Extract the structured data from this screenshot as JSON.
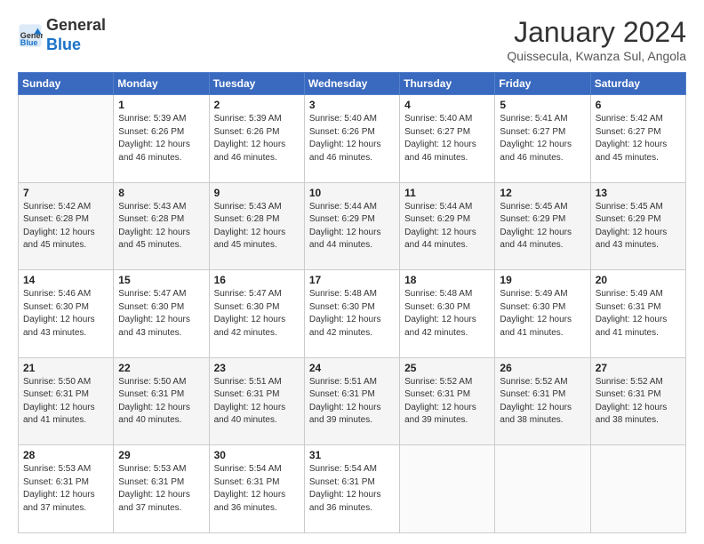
{
  "logo": {
    "line1": "General",
    "line2": "Blue"
  },
  "header": {
    "title": "January 2024",
    "location": "Quissecula, Kwanza Sul, Angola"
  },
  "weekdays": [
    "Sunday",
    "Monday",
    "Tuesday",
    "Wednesday",
    "Thursday",
    "Friday",
    "Saturday"
  ],
  "weeks": [
    [
      {
        "day": "",
        "sunrise": "",
        "sunset": "",
        "daylight": ""
      },
      {
        "day": "1",
        "sunrise": "5:39 AM",
        "sunset": "6:26 PM",
        "daylight": "12 hours and 46 minutes."
      },
      {
        "day": "2",
        "sunrise": "5:39 AM",
        "sunset": "6:26 PM",
        "daylight": "12 hours and 46 minutes."
      },
      {
        "day": "3",
        "sunrise": "5:40 AM",
        "sunset": "6:26 PM",
        "daylight": "12 hours and 46 minutes."
      },
      {
        "day": "4",
        "sunrise": "5:40 AM",
        "sunset": "6:27 PM",
        "daylight": "12 hours and 46 minutes."
      },
      {
        "day": "5",
        "sunrise": "5:41 AM",
        "sunset": "6:27 PM",
        "daylight": "12 hours and 46 minutes."
      },
      {
        "day": "6",
        "sunrise": "5:42 AM",
        "sunset": "6:27 PM",
        "daylight": "12 hours and 45 minutes."
      }
    ],
    [
      {
        "day": "7",
        "sunrise": "5:42 AM",
        "sunset": "6:28 PM",
        "daylight": "12 hours and 45 minutes."
      },
      {
        "day": "8",
        "sunrise": "5:43 AM",
        "sunset": "6:28 PM",
        "daylight": "12 hours and 45 minutes."
      },
      {
        "day": "9",
        "sunrise": "5:43 AM",
        "sunset": "6:28 PM",
        "daylight": "12 hours and 45 minutes."
      },
      {
        "day": "10",
        "sunrise": "5:44 AM",
        "sunset": "6:29 PM",
        "daylight": "12 hours and 44 minutes."
      },
      {
        "day": "11",
        "sunrise": "5:44 AM",
        "sunset": "6:29 PM",
        "daylight": "12 hours and 44 minutes."
      },
      {
        "day": "12",
        "sunrise": "5:45 AM",
        "sunset": "6:29 PM",
        "daylight": "12 hours and 44 minutes."
      },
      {
        "day": "13",
        "sunrise": "5:45 AM",
        "sunset": "6:29 PM",
        "daylight": "12 hours and 43 minutes."
      }
    ],
    [
      {
        "day": "14",
        "sunrise": "5:46 AM",
        "sunset": "6:30 PM",
        "daylight": "12 hours and 43 minutes."
      },
      {
        "day": "15",
        "sunrise": "5:47 AM",
        "sunset": "6:30 PM",
        "daylight": "12 hours and 43 minutes."
      },
      {
        "day": "16",
        "sunrise": "5:47 AM",
        "sunset": "6:30 PM",
        "daylight": "12 hours and 42 minutes."
      },
      {
        "day": "17",
        "sunrise": "5:48 AM",
        "sunset": "6:30 PM",
        "daylight": "12 hours and 42 minutes."
      },
      {
        "day": "18",
        "sunrise": "5:48 AM",
        "sunset": "6:30 PM",
        "daylight": "12 hours and 42 minutes."
      },
      {
        "day": "19",
        "sunrise": "5:49 AM",
        "sunset": "6:30 PM",
        "daylight": "12 hours and 41 minutes."
      },
      {
        "day": "20",
        "sunrise": "5:49 AM",
        "sunset": "6:31 PM",
        "daylight": "12 hours and 41 minutes."
      }
    ],
    [
      {
        "day": "21",
        "sunrise": "5:50 AM",
        "sunset": "6:31 PM",
        "daylight": "12 hours and 41 minutes."
      },
      {
        "day": "22",
        "sunrise": "5:50 AM",
        "sunset": "6:31 PM",
        "daylight": "12 hours and 40 minutes."
      },
      {
        "day": "23",
        "sunrise": "5:51 AM",
        "sunset": "6:31 PM",
        "daylight": "12 hours and 40 minutes."
      },
      {
        "day": "24",
        "sunrise": "5:51 AM",
        "sunset": "6:31 PM",
        "daylight": "12 hours and 39 minutes."
      },
      {
        "day": "25",
        "sunrise": "5:52 AM",
        "sunset": "6:31 PM",
        "daylight": "12 hours and 39 minutes."
      },
      {
        "day": "26",
        "sunrise": "5:52 AM",
        "sunset": "6:31 PM",
        "daylight": "12 hours and 38 minutes."
      },
      {
        "day": "27",
        "sunrise": "5:52 AM",
        "sunset": "6:31 PM",
        "daylight": "12 hours and 38 minutes."
      }
    ],
    [
      {
        "day": "28",
        "sunrise": "5:53 AM",
        "sunset": "6:31 PM",
        "daylight": "12 hours and 37 minutes."
      },
      {
        "day": "29",
        "sunrise": "5:53 AM",
        "sunset": "6:31 PM",
        "daylight": "12 hours and 37 minutes."
      },
      {
        "day": "30",
        "sunrise": "5:54 AM",
        "sunset": "6:31 PM",
        "daylight": "12 hours and 36 minutes."
      },
      {
        "day": "31",
        "sunrise": "5:54 AM",
        "sunset": "6:31 PM",
        "daylight": "12 hours and 36 minutes."
      },
      {
        "day": "",
        "sunrise": "",
        "sunset": "",
        "daylight": ""
      },
      {
        "day": "",
        "sunrise": "",
        "sunset": "",
        "daylight": ""
      },
      {
        "day": "",
        "sunrise": "",
        "sunset": "",
        "daylight": ""
      }
    ]
  ]
}
